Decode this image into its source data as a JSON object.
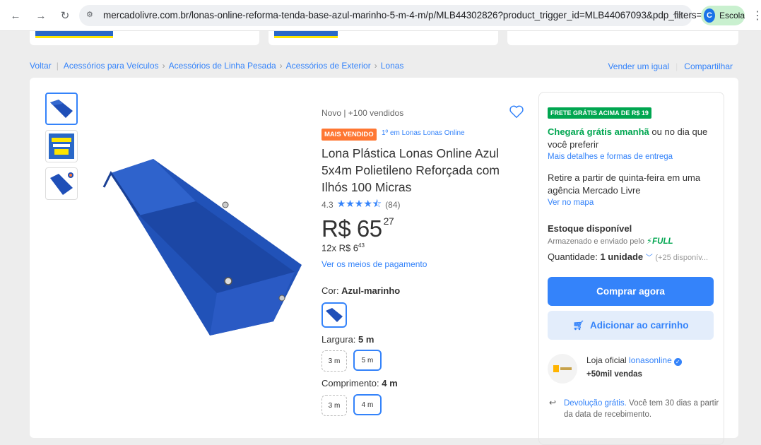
{
  "browser": {
    "url": "mercadolivre.com.br/lonas-online-reforma-tenda-base-azul-marinho-5-m-4-m/p/MLB44302826?product_trigger_id=MLB44067093&pdp_filters=item_...",
    "profile_initial": "C",
    "profile_name": "Escola"
  },
  "breadcrumb": {
    "back": "Voltar",
    "items": [
      "Acessórios para Veículos",
      "Acessórios de Linha Pesada",
      "Acessórios de Exterior",
      "Lonas"
    ]
  },
  "top_links": {
    "sell": "Vender um igual",
    "share": "Compartilhar"
  },
  "product": {
    "condition": "Novo | +100 vendidos",
    "badge": "MAIS VENDIDO",
    "rank": "1º em Lonas Lonas Online",
    "title": "Lona Plástica Lonas Online Azul 5x4m Polietileno Reforçada com Ilhós 100 Micras",
    "rating": "4.3",
    "stars": 4.3,
    "reviews": "(84)",
    "price_main": "R$ 65",
    "price_cents": "27",
    "installments": "12x R$ 6",
    "installments_cents": "43",
    "payment_link": "Ver os meios de pagamento",
    "color_label": "Cor: ",
    "color_value": "Azul-marinho",
    "width_label": "Largura: ",
    "width_value": "5 m",
    "width_options": [
      "3 m",
      "5 m"
    ],
    "length_label": "Comprimento: ",
    "length_value": "4 m",
    "length_options": [
      "3 m",
      "4 m"
    ]
  },
  "buybox": {
    "free_tag": "FRETE GRÁTIS ACIMA DE R$ 19",
    "arrive_green": "Chegará grátis amanhã",
    "arrive_rest": " ou no dia que você preferir",
    "ship_link": "Mais detalhes e formas de entrega",
    "pickup": "Retire a partir de quinta-feira em uma agência Mercado Livre",
    "map_link": "Ver no mapa",
    "stock": "Estoque disponível",
    "sent": "Armazenado e enviado pelo ",
    "full": "FULL",
    "qty_label": "Quantidade: ",
    "qty_value": "1 unidade",
    "qty_more": "(+25 disponív...",
    "buy": "Comprar agora",
    "cart": "Adicionar ao carrinho",
    "store_prefix": "Loja oficial ",
    "store_name": "lonasonline",
    "sales": "+50mil vendas",
    "return_link": "Devolução grátis.",
    "return_rest": " Você tem 30 dias a partir da data de recebimento."
  },
  "colors": {
    "accent": "#3483fa",
    "green": "#00a650",
    "orange": "#ff7733",
    "tarp": "#1f4fb8"
  }
}
